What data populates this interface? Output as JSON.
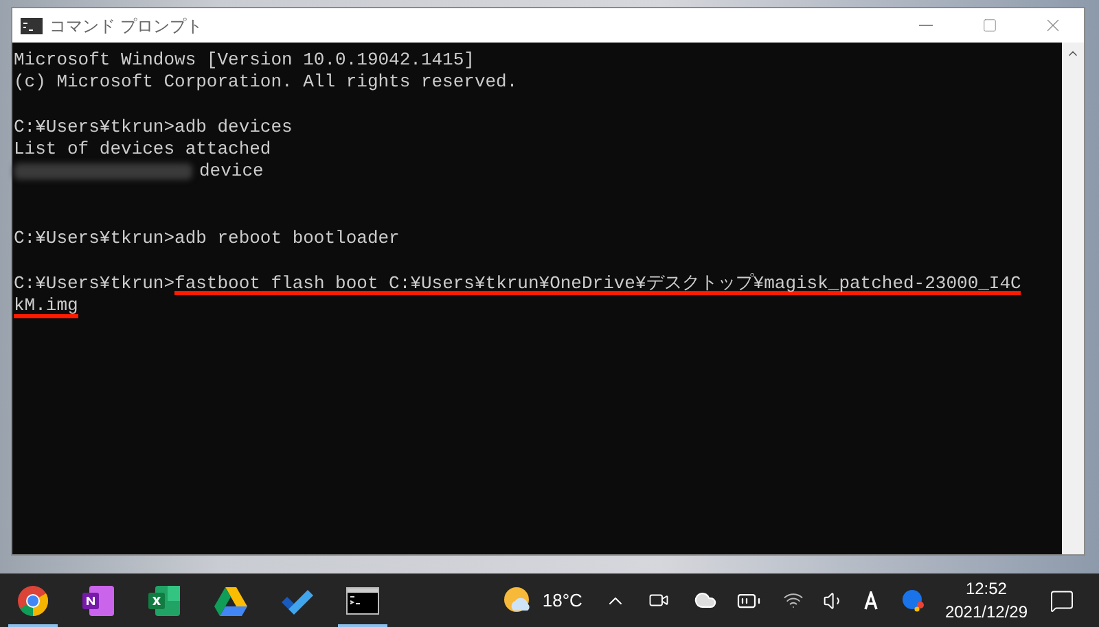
{
  "window": {
    "title": "コマンド プロンプト"
  },
  "console": {
    "lines": [
      {
        "kind": "text",
        "segments": [
          {
            "text": "Microsoft Windows [Version 10.0.19042.1415]",
            "underlined": false
          }
        ]
      },
      {
        "kind": "text",
        "segments": [
          {
            "text": "(c) Microsoft Corporation. All rights reserved.",
            "underlined": false
          }
        ]
      },
      {
        "kind": "blank"
      },
      {
        "kind": "text",
        "segments": [
          {
            "text": "C:¥Users¥tkrun>adb devices",
            "underlined": false
          }
        ]
      },
      {
        "kind": "text",
        "segments": [
          {
            "text": "List of devices attached",
            "underlined": false
          }
        ]
      },
      {
        "kind": "redacted",
        "segments": [
          {
            "text": "device",
            "underlined": false
          }
        ]
      },
      {
        "kind": "blank"
      },
      {
        "kind": "blank"
      },
      {
        "kind": "text",
        "segments": [
          {
            "text": "C:¥Users¥tkrun>adb reboot bootloader",
            "underlined": false
          }
        ]
      },
      {
        "kind": "blank"
      },
      {
        "kind": "text",
        "segments": [
          {
            "text": "C:¥Users¥tkrun>",
            "underlined": false
          },
          {
            "text": "fastboot flash boot C:¥Users¥tkrun¥OneDrive¥デスクトップ¥magisk_patched-23000_I4C",
            "underlined": true
          }
        ]
      },
      {
        "kind": "text",
        "segments": [
          {
            "text": "kM.img",
            "underlined": true
          }
        ]
      }
    ]
  },
  "taskbar": {
    "apps": [
      {
        "kind": "chrome",
        "running": true
      },
      {
        "kind": "onenote",
        "running": false
      },
      {
        "kind": "excel",
        "running": false
      },
      {
        "kind": "drive",
        "running": false
      },
      {
        "kind": "todo",
        "running": false
      },
      {
        "kind": "terminal",
        "running": true
      }
    ],
    "weather": {
      "temperature": "18°C"
    },
    "clock": {
      "time": "12:52",
      "date": "2021/12/29"
    }
  }
}
